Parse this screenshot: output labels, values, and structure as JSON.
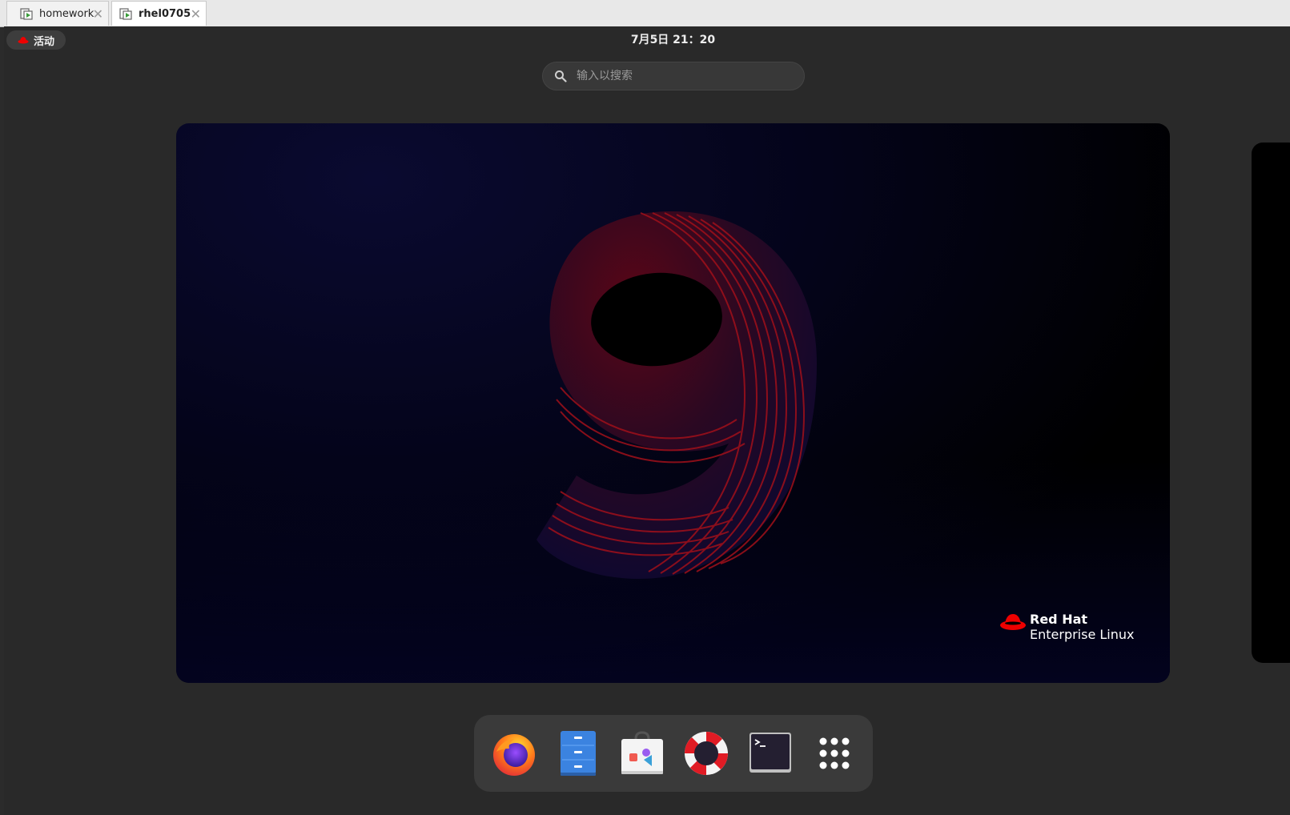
{
  "vm_tabs": [
    {
      "label": "homework",
      "close": "✕"
    },
    {
      "label": "rhel0705",
      "close": "✕"
    }
  ],
  "topbar": {
    "activities_label": "活动",
    "clock": "7月5日  21：20"
  },
  "search": {
    "placeholder": "输入以搜索"
  },
  "wallpaper": {
    "logo_line1": "Red Hat",
    "logo_line2": "Enterprise Linux"
  },
  "dash": {
    "apps": [
      "firefox-icon",
      "files-icon",
      "software-icon",
      "help-icon",
      "terminal-icon",
      "show-apps-icon"
    ]
  },
  "colors": {
    "redhat_red": "#ee0000",
    "panel_bg": "#292929",
    "dash_bg": "#3a3a3a"
  }
}
